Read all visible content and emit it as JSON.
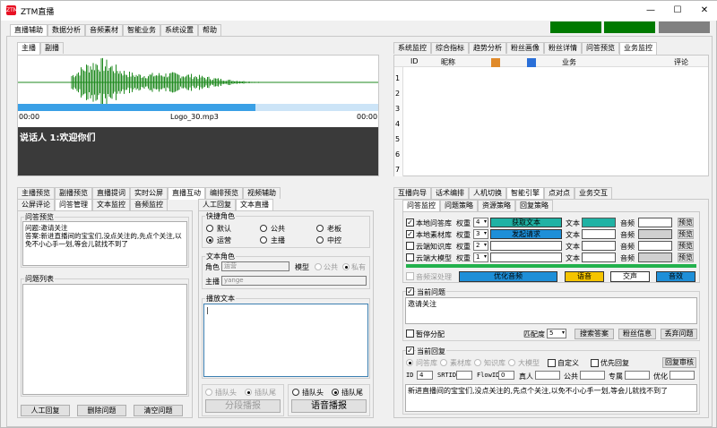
{
  "app": {
    "title": "ZTM直播",
    "logo_text": "ZTM"
  },
  "window_controls": {
    "minimize": "—",
    "maximize": "☐",
    "close": "✕"
  },
  "menu_tabs": [
    "直播辅助",
    "数据分析",
    "音频素材",
    "智能业务",
    "系统设置",
    "帮助"
  ],
  "status_colors": [
    "#007a00",
    "#007a00",
    "#808080"
  ],
  "audio": {
    "tabs": [
      "主播",
      "副播"
    ],
    "start_time": "00:00",
    "end_time": "00:00",
    "file_name": "Logo_30.mp3",
    "wave_color": "#1f8a1f",
    "progress": 0.66,
    "progress_color": "#3aa0e6",
    "speaker_text": "说话人 1:欢迎你们"
  },
  "monitor": {
    "tabs": [
      "系统监控",
      "综合指标",
      "趋势分析",
      "粉丝画像",
      "粉丝详情",
      "问答预览",
      "业务监控"
    ],
    "columns": [
      "ID",
      "昵称",
      "",
      "",
      "业务",
      "",
      "",
      "",
      "评论"
    ],
    "row_numbers": [
      "1",
      "2",
      "3",
      "4",
      "5",
      "6",
      "7"
    ]
  },
  "left_tabs_row1": [
    "主播预览",
    "副播预览",
    "直播提词",
    "实时公屏",
    "直播互动",
    "编排预览",
    "视频辅助"
  ],
  "left_tabs_row2": [
    "公屏评论",
    "问答管理",
    "文本监控",
    "音频监控"
  ],
  "qa_preview": {
    "label": "问答预览",
    "line1": "问题:邀请关注",
    "line2": "答案:新进直播间的宝宝们,没点关注的,先点个关注,以免不小心手一划,等会儿就找不到了"
  },
  "question_list": {
    "label": "问题列表"
  },
  "left_buttons": {
    "manual_reply": "人工回复",
    "delete_question": "删除问题",
    "clear_questions": "清空问题"
  },
  "manual_tabs": [
    "人工回复",
    "文本直播"
  ],
  "quick_roles": {
    "label": "快捷角色",
    "options": [
      "默认",
      "公共",
      "老板",
      "运营",
      "主播",
      "中控"
    ],
    "selected": "运营"
  },
  "text_role": {
    "label": "文本角色",
    "role_label": "角色",
    "role_value": "运营",
    "model_label": "模型",
    "model_public": "公共",
    "model_private": "私有",
    "anchor_label": "主播",
    "anchor_value": "yange"
  },
  "broadcast_text": {
    "label": "播放文本",
    "value": "|"
  },
  "insert_left": {
    "head": "插队头",
    "tail": "插队尾",
    "button": "分段播报"
  },
  "insert_right": {
    "head": "插队头",
    "tail": "插队尾",
    "button": "语音播报"
  },
  "engine_tabs_row1": [
    "互播向导",
    "话术编排",
    "人机切换",
    "智能引擎",
    "点对点",
    "业务交互"
  ],
  "engine_tabs_row2": [
    "问答监控",
    "问题策略",
    "资源策略",
    "回复策略"
  ],
  "kb_rows": [
    {
      "name": "本地问答库",
      "checked": true,
      "weight_label": "权重",
      "weight": "4",
      "action": "获取文本",
      "action_color": "#20b2a4",
      "text_label": "文本",
      "text_color": "#20b2a4",
      "audio_label": "音频",
      "audio_color": "#ffffff",
      "preview": "预览"
    },
    {
      "name": "本地素材库",
      "checked": true,
      "weight_label": "权重",
      "weight": "3",
      "action": "发起请求",
      "action_color": "#1e8fd8",
      "text_label": "文本",
      "text_color": "#ffffff",
      "audio_label": "音频",
      "audio_color": "#d0d0d0",
      "preview": "预览"
    },
    {
      "name": "云端知识库",
      "checked": false,
      "weight_label": "权重",
      "weight": "2",
      "action": "",
      "action_color": "#ffffff",
      "text_label": "文本",
      "text_color": "#ffffff",
      "audio_label": "音频",
      "audio_color": "#ffffff",
      "preview": "预览"
    },
    {
      "name": "云端大模型",
      "checked": false,
      "weight_label": "权重",
      "weight": "1",
      "action": "",
      "action_color": "#ffffff",
      "text_label": "文本",
      "text_color": "#ffffff",
      "audio_label": "音频",
      "audio_color": "#d0d0d0",
      "preview": "预览"
    }
  ],
  "green_bar_color": "#22b14c",
  "audio_process": {
    "label": "音频深处理",
    "optimize": "优化音频",
    "optimize_color": "#1e8fd8",
    "voice": "语音",
    "voice_color": "#f5c400",
    "interact": "交声",
    "interact_color": "#ffffff",
    "sfx": "音效",
    "sfx_color": "#1e8fd8"
  },
  "current_question": {
    "label": "当前问题",
    "checked": true,
    "text": "邀请关注",
    "pause_label": "暂停分配",
    "match_label": "匹配度",
    "match_value": "5",
    "search_answer": "搜索答案",
    "fan_info": "粉丝信息",
    "discard_question": "丢弃问题"
  },
  "current_reply": {
    "label": "当前回复",
    "checked": true,
    "sources": [
      "问答库",
      "素材库",
      "知识库",
      "大模型"
    ],
    "custom": "自定义",
    "priority_reply": "优先回复",
    "review": "回复审核",
    "id_label": "ID",
    "id_value": "4",
    "srtid_label": "SRTID",
    "flowid_label": "FlowID",
    "flowid_value": "0",
    "real_person": "真人",
    "public": "公共",
    "exclusive": "专属",
    "optimize": "优化",
    "text": "新进直播间的宝宝们,没点关注的,先点个关注,以免不小心手一划,等会儿就找不到了"
  }
}
